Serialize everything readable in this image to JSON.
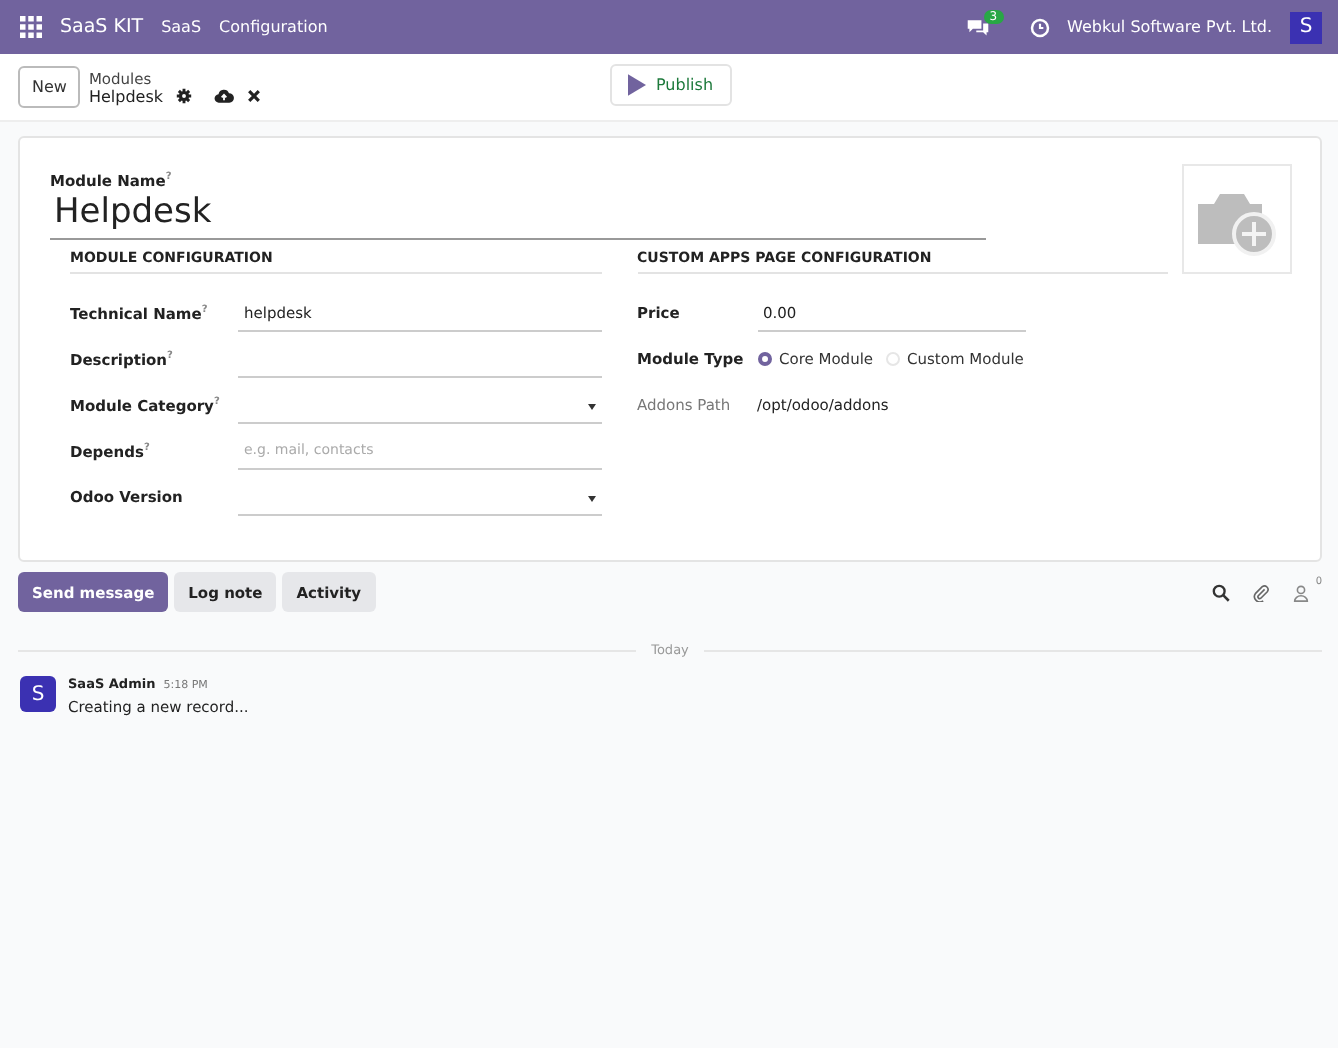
{
  "navbar": {
    "app": "SaaS KIT",
    "menus": [
      "SaaS",
      "Configuration"
    ],
    "chat_count": "3",
    "company": "Webkul Software Pvt. Ltd.",
    "avatar": "S"
  },
  "control_panel": {
    "new_button": "New",
    "breadcrumb": "Modules",
    "record": "Helpdesk",
    "publish": "Publish"
  },
  "form": {
    "name_label": "Module Name$^{?}$",
    "name": "Helpdesk",
    "left": {
      "title": "MODULE CONFIGURATION",
      "fields": [
        {
          "label": "Technical Name$^{?}$",
          "kind": "text",
          "value": "helpdesk"
        },
        {
          "label": "Description$^{?}$",
          "kind": "text"
        },
        {
          "label": "Module Category$^{?}$",
          "kind": "select"
        },
        {
          "label": "Depends$^{?}$",
          "kind": "text",
          "placeholder": "e.g. mail, contacts"
        },
        {
          "label": "Odoo Version",
          "kind": "select"
        }
      ]
    },
    "right": {
      "title": "CUSTOM APPS PAGE CONFIGURATION",
      "price_label": "Price",
      "price": "0.00",
      "type_label": "Module Type",
      "options": [
        {
          "label": "Core Module",
          "selected": true
        },
        {
          "label": "Custom Module",
          "selected": false
        }
      ],
      "addons_label": "Addons Path",
      "addons_path": "/opt/odoo/addons"
    }
  },
  "chatter": {
    "buttons": [
      {
        "label": "Send message",
        "selected": true
      },
      {
        "label": "Log note",
        "selected": false
      },
      {
        "label": "Activity",
        "selected": false
      }
    ],
    "follower_count": "0",
    "date": "Today",
    "messages": [
      {
        "avatar": "S",
        "author": "SaaS Admin",
        "time": "5:18 PM",
        "body": "Creating a new record..."
      }
    ]
  }
}
